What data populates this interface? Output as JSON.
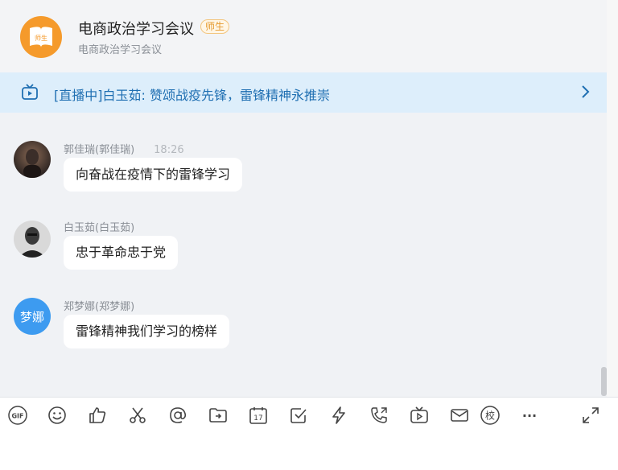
{
  "header": {
    "title": "电商政治学习会议",
    "badge": "师生",
    "subtitle": "电商政治学习会议",
    "avatar_text": "师生"
  },
  "live": {
    "text": "[直播中]白玉茹: 赞颂战疫先锋，雷锋精神永推崇"
  },
  "messages": [
    {
      "sender": "郭佳瑞(郭佳瑞)",
      "time": "18:26",
      "text": "向奋战在疫情下的雷锋学习"
    },
    {
      "sender": "白玉茹(白玉茹)",
      "text": "忠于革命忠于党"
    },
    {
      "sender": "郑梦娜(郑梦娜)",
      "avatar_text": "梦娜",
      "text": "雷锋精神我们学习的榜样"
    }
  ],
  "toolbar": {
    "gif": "GIF",
    "calendar_day": "17",
    "xiao": "校",
    "more": "···"
  },
  "colors": {
    "accent": "#3d9bf0",
    "live_bg": "#ddeefb",
    "live_text": "#1f6fb2",
    "badge": "#e59a2f",
    "group_avatar": "#f59a2b"
  }
}
